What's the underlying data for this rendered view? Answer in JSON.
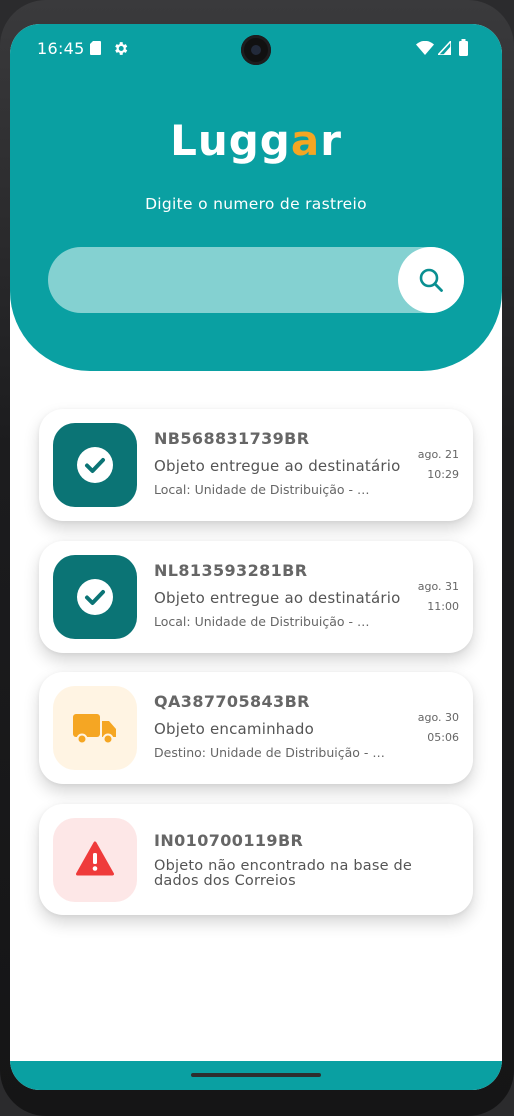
{
  "status_bar": {
    "time": "16:45"
  },
  "header": {
    "logo_main": "Lugg",
    "logo_accent": "a",
    "logo_end": "r",
    "subtitle": "Digite o numero de rastreio",
    "search_placeholder": ""
  },
  "colors": {
    "brand": "#0aa0a2",
    "accent": "#f5a623",
    "delivered": "#0b7475",
    "in_transit_bg": "#fff4e3",
    "in_transit": "#f5a623",
    "error_bg": "#fde7e7",
    "error": "#ef3b3b"
  },
  "packages": [
    {
      "code": "NB568831739BR",
      "status": "Objeto entregue ao destinatário",
      "location": "Local: Unidade de Distribuição - …",
      "date": "ago. 21",
      "time": "10:29",
      "icon": "check-circle-icon"
    },
    {
      "code": "NL813593281BR",
      "status": "Objeto entregue ao destinatário",
      "location": "Local: Unidade de Distribuição - …",
      "date": "ago. 31",
      "time": "11:00",
      "icon": "check-circle-icon"
    },
    {
      "code": "QA387705843BR",
      "status": "Objeto encaminhado",
      "location": "Destino: Unidade de Distribuição - …",
      "date": "ago. 30",
      "time": "05:06",
      "icon": "truck-icon"
    },
    {
      "code": "IN010700119BR",
      "status": "Objeto não encontrado na base de dados dos Correios",
      "icon": "warning-icon"
    }
  ]
}
